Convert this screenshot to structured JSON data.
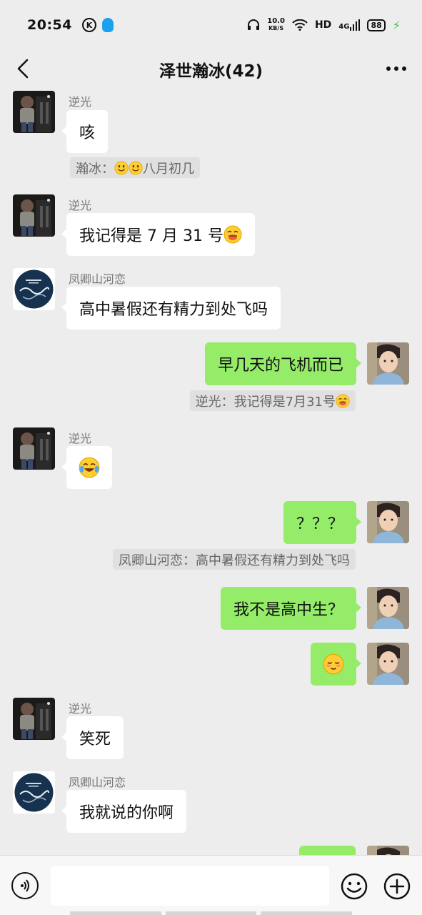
{
  "status_bar": {
    "time": "20:54",
    "k_icon": "K",
    "speed_top": "10.0",
    "speed_bottom": "KB/S",
    "hd": "HD",
    "network": "4G",
    "battery": "88"
  },
  "header": {
    "title": "泽世瀚冰(42)",
    "back_icon": "chevron-left-icon",
    "more_icon": "more-dots-icon"
  },
  "messages": [
    {
      "side": "in",
      "sender": "逆光",
      "text": "咳"
    },
    {
      "type": "quote",
      "prefix": "瀚冰：",
      "emojis": [
        "smile-emoji",
        "smile-emoji"
      ],
      "text": "八月初几"
    },
    {
      "side": "in",
      "sender": "逆光",
      "text": "我记得是 7 月 31 号",
      "emoji": "drooling-face-emoji"
    },
    {
      "side": "in",
      "sender": "凤卿山河恋",
      "text": "高中暑假还有精力到处飞吗"
    },
    {
      "side": "out",
      "text": "早几天的飞机而已"
    },
    {
      "type": "quote",
      "text": "逆光：我记得是7月31号",
      "emoji": "drooling-face-emoji"
    },
    {
      "side": "in",
      "sender": "逆光",
      "emoji": "tears-of-joy-emoji"
    },
    {
      "side": "out",
      "text": "？？？"
    },
    {
      "type": "quote",
      "text": "凤卿山河恋：高中暑假还有精力到处飞吗"
    },
    {
      "side": "out",
      "text": "我不是高中生？"
    },
    {
      "side": "out",
      "emoji": "relieved-face-emoji"
    },
    {
      "side": "in",
      "sender": "逆光",
      "text": "笑死"
    },
    {
      "side": "in",
      "sender": "凤卿山河恋",
      "text": "我就说的你啊"
    }
  ],
  "input_bar": {
    "value": "",
    "placeholder": "",
    "voice_icon": "voice-icon",
    "emoji_icon": "emoji-icon",
    "plus_icon": "plus-icon"
  },
  "colors": {
    "background": "#ededed",
    "outgoing_bubble": "#95ec69",
    "incoming_bubble": "#ffffff",
    "quote_bg": "#e0e0e0"
  }
}
